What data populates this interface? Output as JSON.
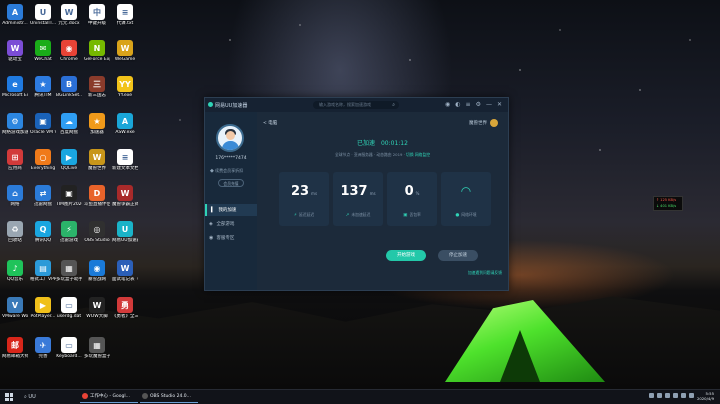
{
  "desktop": {
    "icons": [
      {
        "label": "Administr...",
        "color": "#2b7bd8",
        "glyph": "A"
      },
      {
        "label": "UninstallT...",
        "color": "#ffffff",
        "glyph": "U"
      },
      {
        "label": "元元.docx",
        "color": "#ffffff",
        "glyph": "W"
      },
      {
        "label": "中键升级",
        "color": "#ffffff",
        "glyph": "中"
      },
      {
        "label": "代课.txt",
        "color": "#ffffff",
        "glyph": "≡"
      },
      {
        "label": "驱动宝",
        "color": "#7b4dd6",
        "glyph": "W"
      },
      {
        "label": "WeChat",
        "color": "#1aad19",
        "glyph": "✉"
      },
      {
        "label": "Chrome",
        "color": "#e84336",
        "glyph": "◉"
      },
      {
        "label": "GeForce Experience",
        "color": "#76b900",
        "glyph": "N"
      },
      {
        "label": "WeGame",
        "color": "#d9a31a",
        "glyph": "W"
      },
      {
        "label": "Microsoft Edge",
        "color": "#1f7ae0",
        "glyph": "e"
      },
      {
        "label": "腾讯TIM",
        "color": "#2d7be0",
        "glyph": "★"
      },
      {
        "label": "BGLinkSet...",
        "color": "#2b6fd6",
        "glyph": "B"
      },
      {
        "label": "新三国志",
        "color": "#8a3b2b",
        "glyph": "三"
      },
      {
        "label": "YY.exe",
        "color": "#f2c31a",
        "glyph": "YY"
      },
      {
        "label": "网络游戏加速器",
        "color": "#2c86e0",
        "glyph": "⚙"
      },
      {
        "label": "Oracle VM VirtualBox",
        "color": "#1a62b8",
        "glyph": "▣"
      },
      {
        "label": "百度网盘",
        "color": "#2f9ef3",
        "glyph": "☁"
      },
      {
        "label": "加速器",
        "color": "#f09a1a",
        "glyph": "★"
      },
      {
        "label": "ASW.exe",
        "color": "#1aa6d8",
        "glyph": "A"
      },
      {
        "label": "应用商",
        "color": "#d23a3a",
        "glyph": "⊞"
      },
      {
        "label": "Everything",
        "color": "#f07a1a",
        "glyph": "○"
      },
      {
        "label": "QQLive",
        "color": "#1aa6e0",
        "glyph": "▶"
      },
      {
        "label": "魔兽世界",
        "color": "#c8961a",
        "glyph": "W"
      },
      {
        "label": "新建文本文档.txt",
        "color": "#ffffff",
        "glyph": "≡"
      },
      {
        "label": "网络",
        "color": "#2b7bd8",
        "glyph": "⌂"
      },
      {
        "label": "迅雷网盘",
        "color": "#2b7bd8",
        "glyph": "⇄"
      },
      {
        "label": "TIM图片20200226...",
        "color": "#222222",
        "glyph": "▣"
      },
      {
        "label": "斗鱼直播伴侣",
        "color": "#e8632a",
        "glyph": "D"
      },
      {
        "label": "魔兽争霸正式服官方版",
        "color": "#a82a2a",
        "glyph": "W"
      },
      {
        "label": "回收站",
        "color": "#9aa6b2",
        "glyph": "♻"
      },
      {
        "label": "腾讯QQ",
        "color": "#1aa6e0",
        "glyph": "Q"
      },
      {
        "label": "迅雷游戏",
        "color": "#2bb36a",
        "glyph": "⚡"
      },
      {
        "label": "OBS Studio",
        "color": "#303030",
        "glyph": "◎"
      },
      {
        "label": "网易UU加速器",
        "color": "#1ab3c8",
        "glyph": "U"
      },
      {
        "label": "QQ音乐",
        "color": "#1fc35a",
        "glyph": "♪"
      },
      {
        "label": "格式工厂VPR易计划v2.3...",
        "color": "#2b9ad8",
        "glyph": "▤"
      },
      {
        "label": "多玩盒子助手.exe",
        "color": "#555555",
        "glyph": "▦"
      },
      {
        "label": "暴雪战网",
        "color": "#1a7ad8",
        "glyph": "◉"
      },
      {
        "label": "面试笔记表（社会招聘）",
        "color": "#2b5fb8",
        "glyph": "W"
      },
      {
        "label": "VMware Workstat...",
        "color": "#3a7ab8",
        "glyph": "V"
      },
      {
        "label": "PotPlayer...",
        "color": "#f0c01a",
        "glyph": "▶"
      },
      {
        "label": "userdg.dat",
        "color": "#ffffff",
        "glyph": "▭"
      },
      {
        "label": "WOW大脚",
        "color": "#222222",
        "glyph": "W"
      },
      {
        "label": "《勇者》全三国最新",
        "color": "#d23a3a",
        "glyph": "勇"
      },
      {
        "label": "网易邮箱大师",
        "color": "#d8261a",
        "glyph": "邮"
      },
      {
        "label": "完善",
        "color": "#3a7ad8",
        "glyph": "✈"
      },
      {
        "label": "Keyboard...",
        "color": "#ffffff",
        "glyph": "▭"
      },
      {
        "label": "多玩魔兽盒子.exe",
        "color": "#555555",
        "glyph": "▦"
      }
    ]
  },
  "app": {
    "title": "网易UU加速器",
    "search_placeholder": "输入游戏名称，搜索加速游戏",
    "user": {
      "name": "176*****7474",
      "vip_text": "续费会员享折扣",
      "sign_button": "会员充值"
    },
    "nav": [
      {
        "icon": "▍",
        "label": "我的加速"
      },
      {
        "icon": "◈",
        "label": "全部游戏"
      },
      {
        "icon": "◉",
        "label": "客服专区"
      }
    ],
    "back_label": "< 电脑",
    "account_label": "魔兽世界",
    "status_text": "已加速",
    "status_time": "00:01:12",
    "info_text": "全球节点 · 亚洲服务器 · 动态路由 2019 ·",
    "info_link1": "切换",
    "info_link2": "网络监控",
    "stats": [
      {
        "value": "23",
        "unit": "ms",
        "label": "延迟延迟"
      },
      {
        "value": "137",
        "unit": "ms",
        "label": "未加速延迟"
      },
      {
        "value": "0",
        "unit": "%",
        "label": "丢包率"
      }
    ],
    "wifi_label": "网络环境",
    "start_button": "开始游戏",
    "stop_button": "停止加速",
    "feedback_link": "加速遇到问题请反馈"
  },
  "speed_widget": {
    "up": "↑ 125 KB/s",
    "down": "↓ 401 KB/s"
  },
  "taskbar": {
    "search": "UU",
    "apps": [
      {
        "label": "工作中心 - Googl...",
        "color": "#e84336"
      },
      {
        "label": "OBS Studio 24.0...",
        "color": "#303030"
      }
    ],
    "time": "5:55",
    "date": "2020/4/9"
  }
}
